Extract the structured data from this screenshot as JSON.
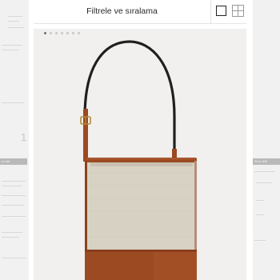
{
  "filter_bar": {
    "label": "Filtrele ve sıralama",
    "view_single_icon": "single-column-view-icon",
    "view_grid_icon": "grid-view-icon"
  },
  "product": {
    "image_alt": "Canvas and leather bucket shoulder bag",
    "carousel_dots": 7,
    "active_dot": 0,
    "colors": {
      "canvas": "#d8d2c4",
      "leather": "#9c4a22",
      "strap": "#1f1f1f",
      "background": "#f1f0ee"
    }
  },
  "background_page": {
    "left_numeral": "1",
    "left_tag": "Lo de",
    "right_tag": "% ar  203"
  }
}
